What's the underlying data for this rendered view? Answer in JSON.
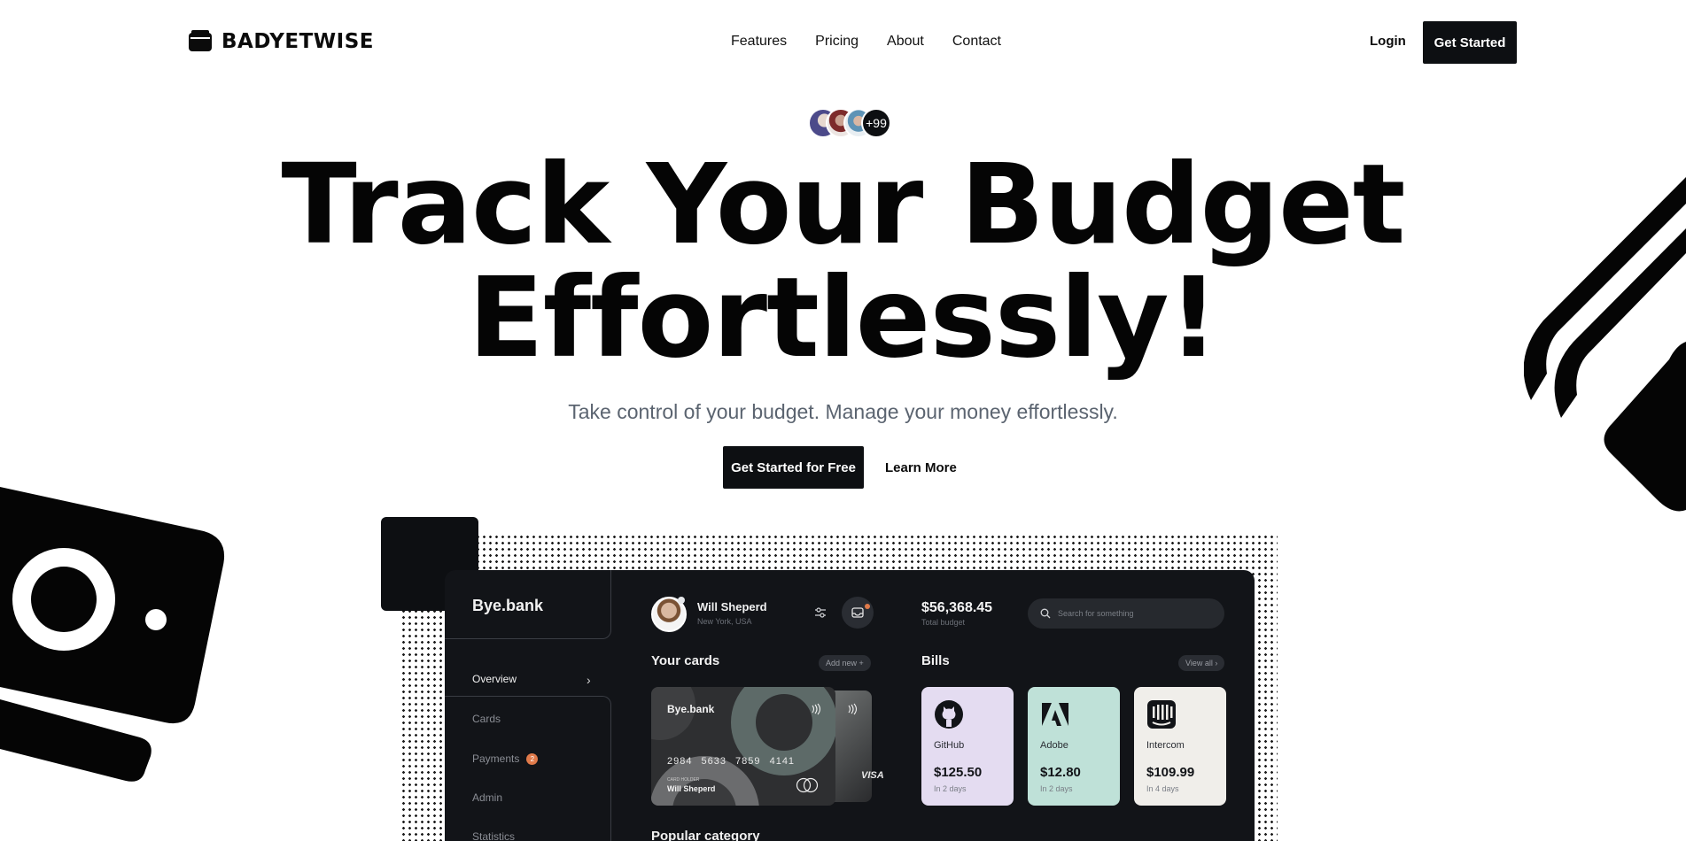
{
  "brand": {
    "name": "BADYETWISE"
  },
  "nav": {
    "links": [
      "Features",
      "Pricing",
      "About",
      "Contact"
    ],
    "login": "Login",
    "cta": "Get Started"
  },
  "social_proof": {
    "count": "+99"
  },
  "hero": {
    "headline_line1": "Track Your Budget",
    "headline_line2": "Effortlessly!",
    "subtitle": "Take control of your budget. Manage your money effortlessly.",
    "primary_cta": "Get Started for Free",
    "secondary_cta": "Learn More"
  },
  "dashboard": {
    "brand": "Bye.bank",
    "menu": [
      {
        "label": "Overview",
        "active": true
      },
      {
        "label": "Cards"
      },
      {
        "label": "Payments",
        "badge": "2"
      },
      {
        "label": "Admin"
      },
      {
        "label": "Statistics"
      }
    ],
    "user": {
      "name": "Will Sheperd",
      "location": "New York, USA"
    },
    "budget": {
      "amount": "$56,368.45",
      "label": "Total budget"
    },
    "search_placeholder": "Search for something",
    "cards_section": {
      "title": "Your cards",
      "add": "Add new +"
    },
    "card": {
      "brand": "Bye.bank",
      "number": "2984 5633 7859 4141",
      "holder_label": "CARD HOLDER",
      "holder": "Will Sheperd",
      "network": "VISA"
    },
    "bills_section": {
      "title": "Bills",
      "view_all": "View all ›"
    },
    "bills": [
      {
        "name": "GitHub",
        "amount": "$125.50",
        "due": "In 2 days",
        "color": "#e4dcf1",
        "icon": "github-icon"
      },
      {
        "name": "Adobe",
        "amount": "$12.80",
        "due": "In 2 days",
        "color": "#bfe1d8",
        "icon": "adobe-icon"
      },
      {
        "name": "Intercom",
        "amount": "$109.99",
        "due": "In 4 days",
        "color": "#f0eeea",
        "icon": "intercom-icon"
      }
    ],
    "category_section": {
      "title": "Popular category"
    }
  },
  "colors": {
    "dark": "#0d0f12",
    "dashboard_bg": "#121418",
    "accent": "#e07a4a",
    "subtitle": "#5b6470"
  }
}
